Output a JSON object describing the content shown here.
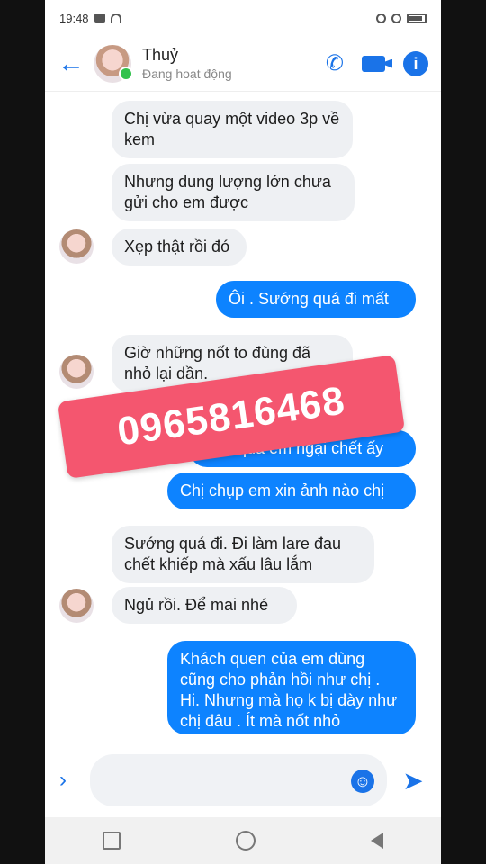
{
  "status_bar": {
    "time": "19:48",
    "left_icons": [
      "mail-icon",
      "wifi-icon"
    ],
    "right_icons": [
      "alarm-icon",
      "circle-icon",
      "battery-icon"
    ]
  },
  "header": {
    "contact_name": "Thuỷ",
    "status": "Đang hoạt động",
    "icons": [
      "back-arrow-icon",
      "phone-icon",
      "video-camera-icon",
      "info-icon"
    ]
  },
  "messages": [
    {
      "direction": "in",
      "text": "Chị vừa quay một video 3p về kem"
    },
    {
      "direction": "in",
      "text": "Nhưng dung lượng lớn chưa gửi cho em được"
    },
    {
      "direction": "in",
      "text": "Xẹp thật rồi đó"
    },
    {
      "direction": "out",
      "text": "Ôi . Sướng quá đi mất"
    },
    {
      "direction": "in",
      "text": "Giờ những nốt to đùng đã nhỏ lại dần."
    },
    {
      "direction": "out",
      "text": "...ệu quá em ngại chết ấy"
    },
    {
      "direction": "out",
      "text": "Chị chụp em xin ảnh nào chị"
    },
    {
      "direction": "in",
      "text": "Sướng quá đi. Đi làm lare đau chết khiếp mà xấu lâu lắm"
    },
    {
      "direction": "in",
      "text": "Ngủ rồi. Để mai nhé"
    },
    {
      "direction": "out",
      "text": "Khách quen của em dùng cũng cho phản hồi như chị . Hi. Nhưng mà họ k bị dày như chị đâu . Ít mà nốt nhỏ"
    }
  ],
  "overlay": {
    "phone_number": "0965816468",
    "color": "#f4566f"
  },
  "composer": {
    "placeholder": "",
    "icons": [
      "chevron-right-icon",
      "emoji-icon",
      "send-icon"
    ]
  },
  "nav_bar": {
    "icons": [
      "recent-apps-icon",
      "home-icon",
      "back-icon"
    ]
  },
  "colors": {
    "accent": "#1a73e8",
    "outgoing_bubble": "#0d83ff",
    "incoming_bubble": "#eef0f3"
  }
}
